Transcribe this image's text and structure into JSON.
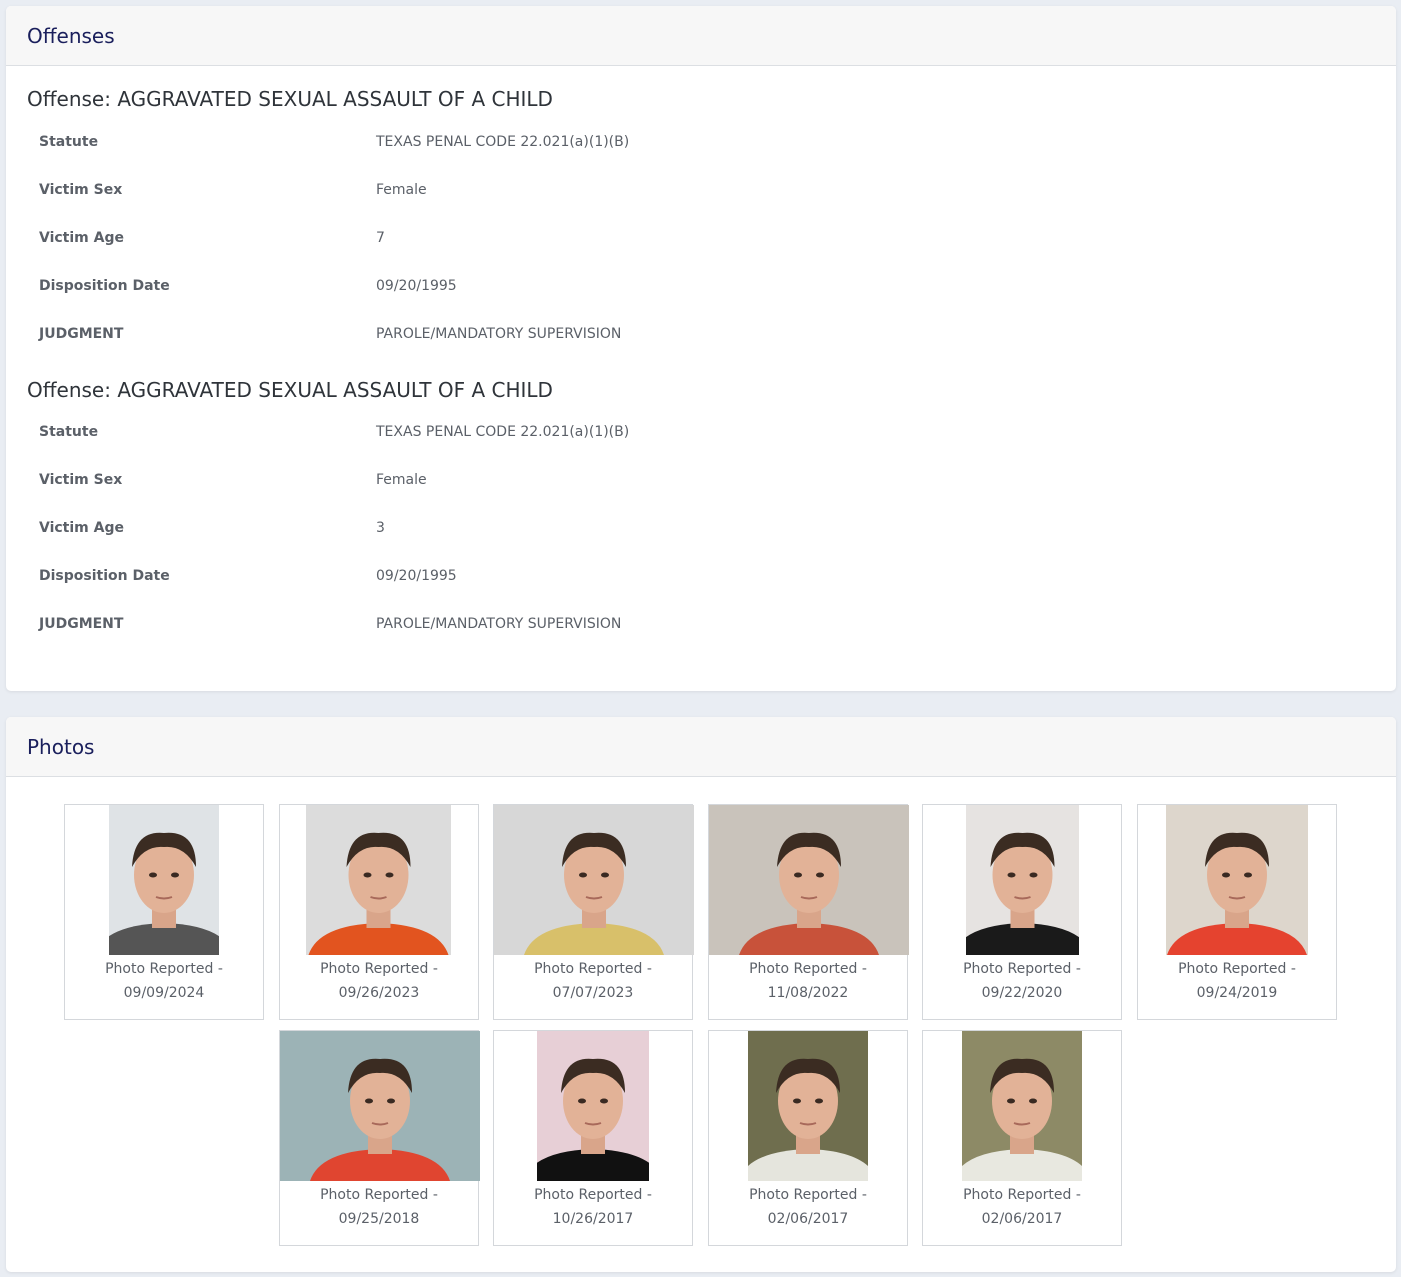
{
  "offenses": {
    "title": "Offenses",
    "items": [
      {
        "title": "Offense: AGGRAVATED SEXUAL ASSAULT OF A CHILD",
        "fields": [
          {
            "label": "Statute",
            "value": "TEXAS PENAL CODE 22.021(a)(1)(B)"
          },
          {
            "label": "Victim Sex",
            "value": "Female"
          },
          {
            "label": "Victim Age",
            "value": "7"
          },
          {
            "label": "Disposition Date",
            "value": "09/20/1995"
          },
          {
            "label": "JUDGMENT",
            "value": "PAROLE/MANDATORY SUPERVISION"
          }
        ]
      },
      {
        "title": "Offense: AGGRAVATED SEXUAL ASSAULT OF A CHILD",
        "fields": [
          {
            "label": "Statute",
            "value": "TEXAS PENAL CODE 22.021(a)(1)(B)"
          },
          {
            "label": "Victim Sex",
            "value": "Female"
          },
          {
            "label": "Victim Age",
            "value": "3"
          },
          {
            "label": "Disposition Date",
            "value": "09/20/1995"
          },
          {
            "label": "JUDGMENT",
            "value": "PAROLE/MANDATORY SUPERVISION"
          }
        ]
      }
    ]
  },
  "photos": {
    "title": "Photos",
    "caption_prefix": "Photo Reported -",
    "items": [
      {
        "date": "09/09/2024",
        "bg": "#dfe3e6",
        "shirt": "#555555"
      },
      {
        "date": "09/26/2023",
        "bg": "#dcdcdc",
        "shirt": "#e2541f"
      },
      {
        "date": "07/07/2023",
        "bg": "#d7d7d7",
        "shirt": "#d8c06a"
      },
      {
        "date": "11/08/2022",
        "bg": "#c9c3bb",
        "shirt": "#c8523a"
      },
      {
        "date": "09/22/2020",
        "bg": "#e6e3e1",
        "shirt": "#1a1a1a"
      },
      {
        "date": "09/24/2019",
        "bg": "#ddd6cc",
        "shirt": "#e5432f"
      },
      {
        "date": "09/25/2018",
        "bg": "#9cb3b6",
        "shirt": "#e04530"
      },
      {
        "date": "10/26/2017",
        "bg": "#e7cfd6",
        "shirt": "#111111"
      },
      {
        "date": "02/06/2017",
        "bg": "#6f6e4e",
        "shirt": "#e5e5dd"
      },
      {
        "date": "02/06/2017",
        "bg": "#8d8a66",
        "shirt": "#e8e8e0"
      }
    ]
  }
}
